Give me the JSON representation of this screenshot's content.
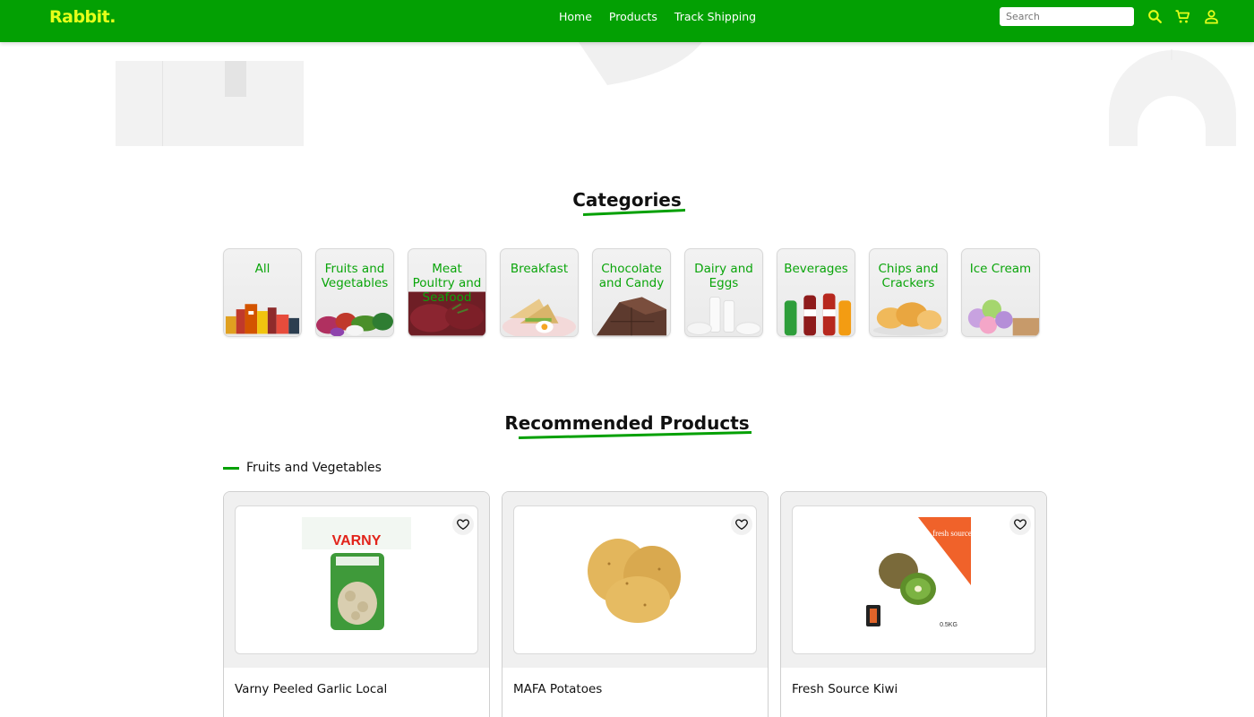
{
  "header": {
    "logo": "Rabbit.",
    "nav": [
      "Home",
      "Products",
      "Track Shipping"
    ],
    "search_placeholder": "Search",
    "icons": [
      "search-icon",
      "cart-icon",
      "user-icon"
    ],
    "brand_color": "#03a003",
    "logo_color": "#e6ff1a"
  },
  "categories": {
    "title": "Categories",
    "items": [
      {
        "label": "All"
      },
      {
        "label": "Fruits and Vegetables"
      },
      {
        "label": "Meat Poultry and Seafood"
      },
      {
        "label": "Breakfast"
      },
      {
        "label": "Chocolate and Candy"
      },
      {
        "label": "Dairy and Eggs"
      },
      {
        "label": "Beverages"
      },
      {
        "label": "Chips and Crackers"
      },
      {
        "label": "Ice Cream"
      }
    ]
  },
  "recommended": {
    "title": "Recommended Products",
    "group_label": "Fruits and Vegetables",
    "products": [
      {
        "name": "Varny Peeled Garlic Local",
        "package_brand": "VARNY"
      },
      {
        "name": "MAFA Potatoes"
      },
      {
        "name": "Fresh Source Kiwi",
        "package_brand": "fresh source",
        "package_weight": "0.5KG"
      }
    ]
  }
}
